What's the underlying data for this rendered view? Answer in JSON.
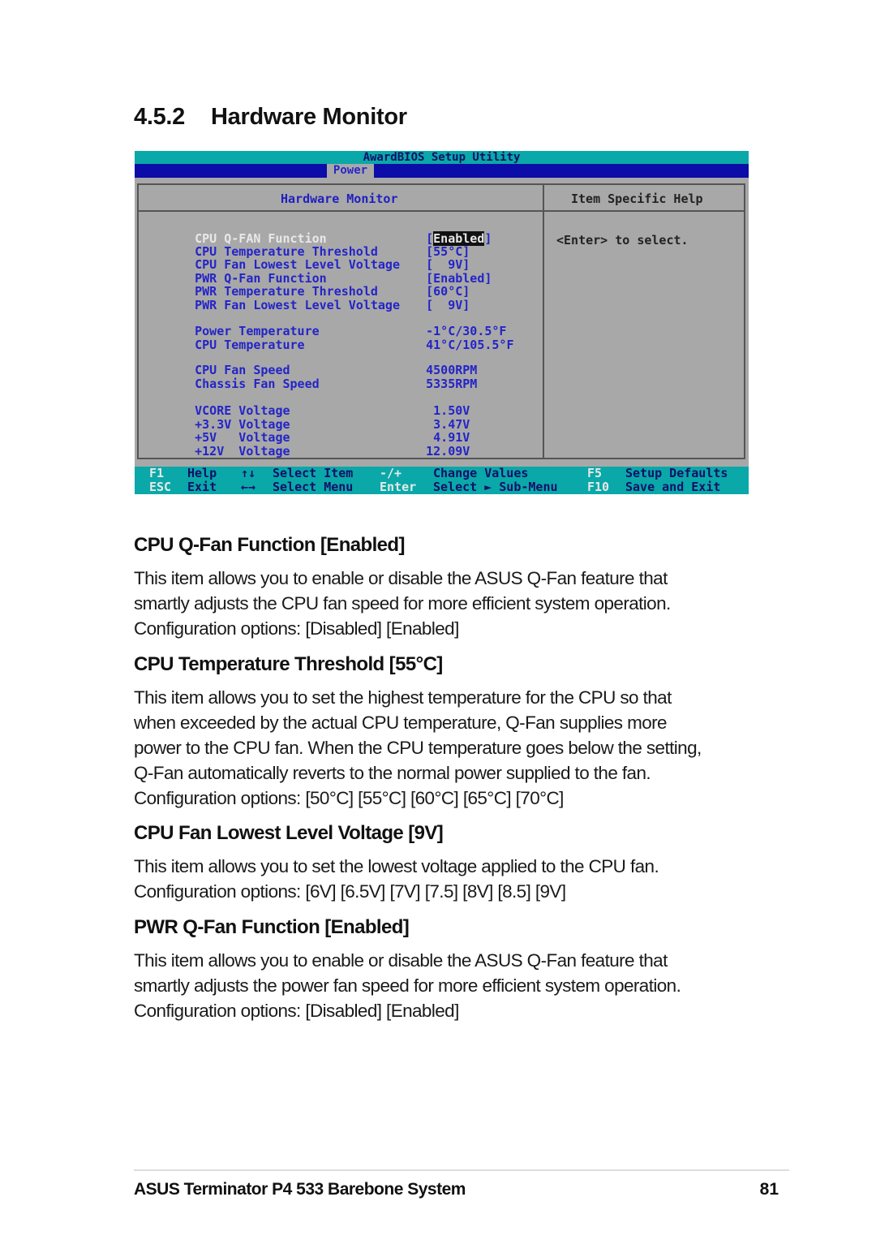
{
  "section": {
    "number": "4.5.2",
    "title": "Hardware Monitor"
  },
  "bios": {
    "title": "AwardBIOS Setup Utility",
    "active_tab": "Power",
    "panel_title": "Hardware Monitor",
    "help_title": "Item Specific Help",
    "help_text": "<Enter> to select.",
    "colors": {
      "title_bar": "#0aa8a8",
      "menu_bar": "#0c0ca8",
      "panel_bg": "#a8a8a8",
      "item_text": "#2424c8",
      "selected_text": "#e8e8e8"
    },
    "items": [
      {
        "label": "CPU Q-FAN Function",
        "value_pre": "[",
        "value_hl": "Enabled",
        "value_post": "]",
        "selected": true
      },
      {
        "label": "CPU Temperature Threshold",
        "value": "[55°C]"
      },
      {
        "label": "CPU Fan Lowest Level Voltage",
        "value": "[  9V]"
      },
      {
        "label": "PWR Q-Fan Function",
        "value": "[Enabled]"
      },
      {
        "label": "PWR Temperature Threshold",
        "value": "[60°C]"
      },
      {
        "label": "PWR Fan Lowest Level Voltage",
        "value": "[  9V]"
      }
    ],
    "temps": [
      {
        "label": "Power Temperature",
        "value": "-1°C/30.5°F"
      },
      {
        "label": "CPU Temperature",
        "value": "41°C/105.5°F"
      }
    ],
    "fans": [
      {
        "label": "CPU Fan Speed",
        "value": "4500RPM"
      },
      {
        "label": "Chassis Fan Speed",
        "value": "5335RPM"
      }
    ],
    "voltages": [
      {
        "label": "VCORE Voltage",
        "value": " 1.50V"
      },
      {
        "label": "+3.3V Voltage",
        "value": " 3.47V"
      },
      {
        "label": "+5V   Voltage",
        "value": " 4.91V"
      },
      {
        "label": "+12V  Voltage",
        "value": "12.09V"
      }
    ],
    "footer": [
      {
        "key": "F1",
        "desc": "Help"
      },
      {
        "key": "ESC",
        "desc": "Exit"
      },
      {
        "key": "↑↓",
        "desc": "Select Item"
      },
      {
        "key": "←→",
        "desc": "Select Menu"
      },
      {
        "key": "-/+",
        "desc": "Change Values"
      },
      {
        "key": "Enter",
        "desc": "Select ► Sub-Menu"
      },
      {
        "key": "F5",
        "desc": "Setup Defaults"
      },
      {
        "key": "F10",
        "desc": "Save and Exit"
      }
    ]
  },
  "items": [
    {
      "heading": "CPU Q-Fan Function [Enabled]",
      "lines": [
        "This item allows you to enable or disable the ASUS Q-Fan feature that",
        "smartly adjusts the CPU fan speed for more efficient system operation.",
        "Configuration options: [Disabled] [Enabled]"
      ]
    },
    {
      "heading": "CPU Temperature Threshold [55°C]",
      "lines": [
        "This item allows you to set the highest temperature for the CPU so that",
        "when exceeded by the actual CPU temperature, Q-Fan supplies more",
        "power to the CPU fan. When the CPU temperature goes below the setting,",
        "Q-Fan automatically reverts to the normal power supplied to the fan.",
        "Configuration options: [50°C] [55°C] [60°C] [65°C] [70°C]"
      ]
    },
    {
      "heading": "CPU Fan Lowest Level Voltage [9V]",
      "lines": [
        "This item allows you to set the lowest voltage applied to the CPU fan.",
        "Configuration options: [6V] [6.5V] [7V] [7.5] [8V] [8.5] [9V]"
      ]
    },
    {
      "heading": "PWR Q-Fan Function [Enabled]",
      "lines": [
        "This item allows you to enable or disable the ASUS Q-Fan feature that",
        "smartly adjusts the power fan speed for more efficient system operation.",
        "Configuration options: [Disabled] [Enabled]"
      ]
    }
  ],
  "footer": {
    "title": "ASUS Terminator P4 533 Barebone System",
    "page": "81"
  }
}
